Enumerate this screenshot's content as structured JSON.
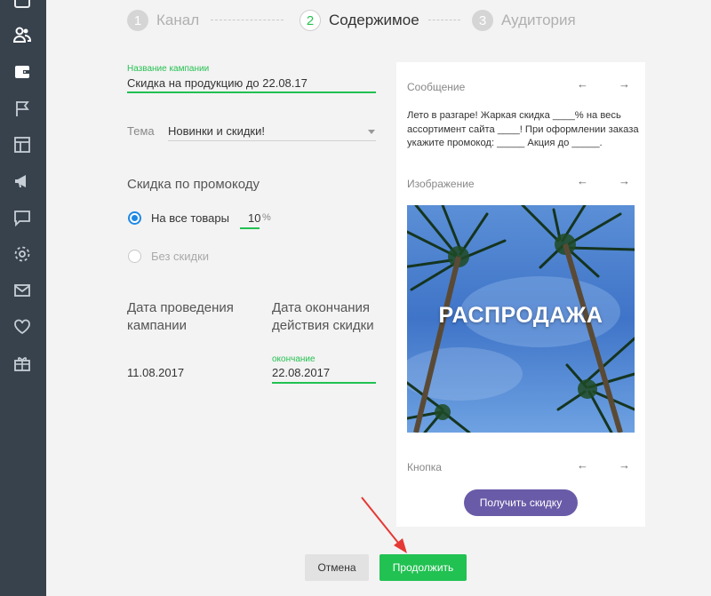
{
  "sidebar": {
    "icons": [
      "top-partial-icon",
      "users-icon",
      "wallet-icon",
      "flag-icon",
      "layout-icon",
      "megaphone-icon",
      "chat-icon",
      "gear-icon",
      "mail-icon",
      "heart-icon",
      "gift-icon"
    ],
    "active_index": 2,
    "bg_color": "#38424d"
  },
  "stepper": {
    "steps": [
      {
        "number": "1",
        "label": "Канал"
      },
      {
        "number": "2",
        "label": "Содержимое"
      },
      {
        "number": "3",
        "label": "Аудитория"
      }
    ],
    "active_step": 2
  },
  "form": {
    "campaign_name_label": "Название кампании",
    "campaign_name_value": "Скидка на продукцию до 22.08.17",
    "theme_label": "Тема",
    "theme_value": "Новинки и скидки!",
    "promo_heading": "Скидка по промокоду",
    "radio_all_label": "На все товары",
    "discount_value": "10",
    "discount_unit": "%",
    "radio_none_label": "Без скидки",
    "start_date_heading_1": "Дата проведения",
    "start_date_heading_2": "кампании",
    "end_date_heading_1": "Дата окончания",
    "end_date_heading_2": "действия скидки",
    "start_date_value": "11.08.2017",
    "end_date_label": "окончание",
    "end_date_value": "22.08.2017"
  },
  "preview": {
    "message_label": "Сообщение",
    "message_text": "Лето в разгаре! Жаркая скидка ____% на весь ассортимент сайта ____! При оформлении заказа укажите промокод: _____ Акция до _____.",
    "image_label": "Изображение",
    "image_text": "РАСПРОДАЖА",
    "button_label": "Кнопка",
    "button_text": "Получить скидку",
    "arrow_left": "←",
    "arrow_right": "→"
  },
  "actions": {
    "cancel_label": "Отмена",
    "next_label": "Продолжить"
  },
  "colors": {
    "accent_green": "#21c152",
    "radio_blue": "#1e88e5",
    "preview_button": "#6a5ba8",
    "annotation_red": "#e53935"
  }
}
